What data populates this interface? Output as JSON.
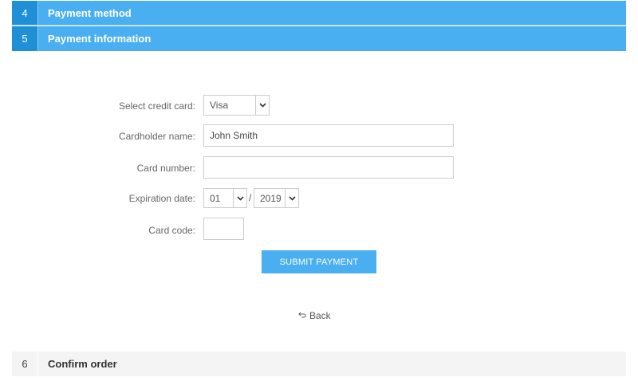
{
  "steps": [
    {
      "number": "4",
      "title": "Payment method"
    },
    {
      "number": "5",
      "title": "Payment information"
    },
    {
      "number": "6",
      "title": "Confirm order"
    }
  ],
  "form": {
    "card_type": {
      "label": "Select credit card:",
      "value": "Visa"
    },
    "cardholder": {
      "label": "Cardholder name:",
      "value": "John Smith"
    },
    "card_number": {
      "label": "Card number:",
      "value": ""
    },
    "expiration": {
      "label": "Expiration date:",
      "month": "01",
      "separator": "/",
      "year": "2019"
    },
    "card_code": {
      "label": "Card code:",
      "value": ""
    }
  },
  "actions": {
    "submit_label": "SUBMIT PAYMENT",
    "back_label": "Back"
  },
  "icons": {
    "dropdown": "chevron-down-icon",
    "back": "back-arrow-icon"
  },
  "colors": {
    "active_step": "#4aaff0",
    "active_step_number": "#1f8fd6",
    "inactive_step": "#f4f4f4",
    "button": "#4aaff0"
  }
}
